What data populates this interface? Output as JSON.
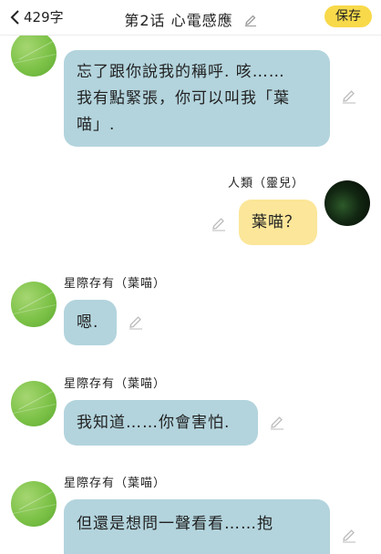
{
  "header": {
    "back_icon": "chevron-left-icon",
    "word_count": "429字",
    "title": "第2话 心電感應",
    "save_label": "保存"
  },
  "messages": [
    {
      "speaker": "",
      "side": "left",
      "lines": [
        "忘了跟你說我的稱呼.  咳……",
        "我有點緊張，你可以叫我「葉",
        "喵」."
      ]
    },
    {
      "speaker": "人類（靈兒）",
      "side": "right",
      "lines": [
        "葉喵？"
      ]
    },
    {
      "speaker": "星際存有（葉喵）",
      "side": "left",
      "lines": [
        "嗯."
      ]
    },
    {
      "speaker": "星際存有（葉喵）",
      "side": "left",
      "lines": [
        "我知道……你會害怕."
      ]
    },
    {
      "speaker": "星際存有（葉喵）",
      "side": "left",
      "lines": [
        "但還是想問一聲看看……抱"
      ]
    }
  ],
  "colors": {
    "bubble_left": "#b3d4dd",
    "bubble_right": "#fbe699",
    "save_button": "#f8d94a"
  }
}
